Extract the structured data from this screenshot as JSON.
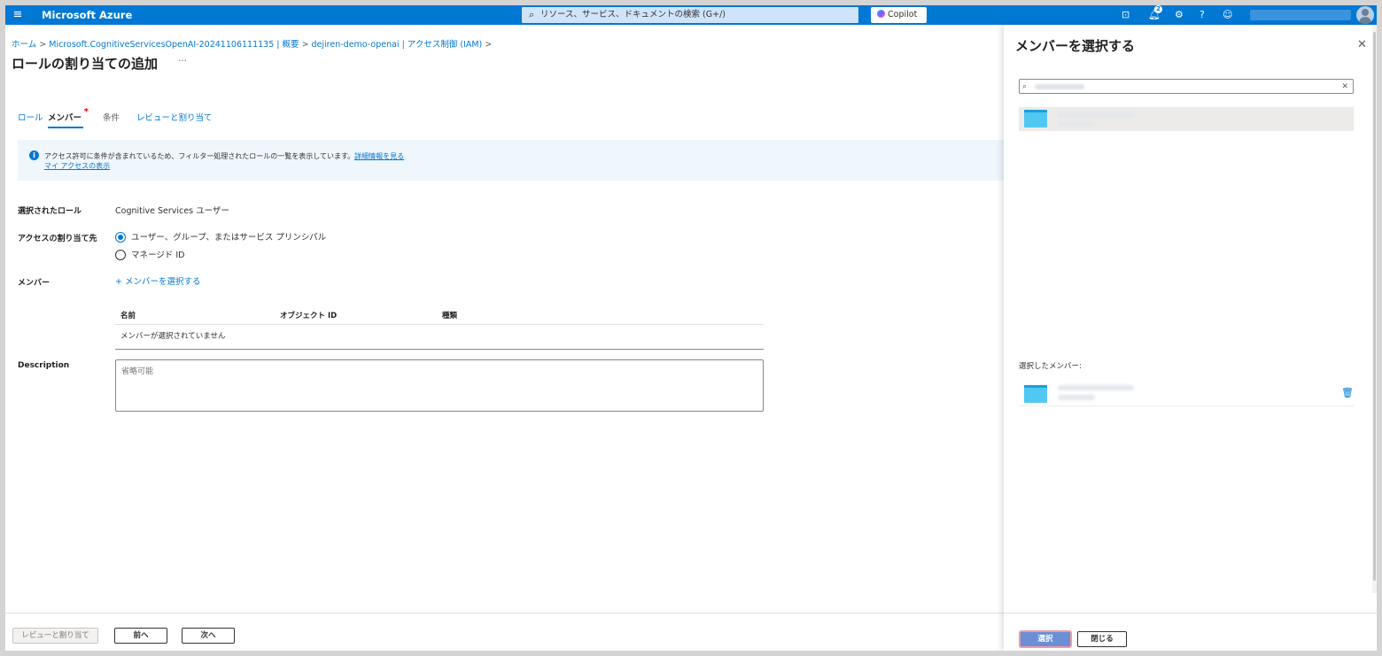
{
  "topbar": {
    "menu_icon": "hamburger-icon",
    "brand": "Microsoft Azure",
    "search_placeholder": "リソース、サービス、ドキュメントの検索 (G+/)",
    "copilot_label": "Copilot",
    "notification_count": "2",
    "icons": [
      "cloud-shell-icon",
      "notifications-icon",
      "settings-icon",
      "help-icon",
      "feedback-icon"
    ]
  },
  "breadcrumb": {
    "items": [
      "ホーム",
      "Microsoft.CognitiveServicesOpenAI-20241106111135 | 概要",
      "dejiren-demo-openai | アクセス制御 (IAM)"
    ],
    "separator": ">"
  },
  "page": {
    "title": "ロールの割り当ての追加",
    "more": "…"
  },
  "tabs": [
    {
      "label": "ロール"
    },
    {
      "label": "メンバー",
      "required_mark": "*"
    },
    {
      "label": "条件"
    },
    {
      "label": "レビューと割り当て"
    }
  ],
  "info": {
    "text": "アクセス許可に条件が含まれているため、フィルター処理されたロールの一覧を表示しています。",
    "link1": "詳細情報を見る",
    "link2": "マイ アクセスの表示"
  },
  "form": {
    "selected_role_label": "選択されたロール",
    "selected_role_value": "Cognitive Services ユーザー",
    "assign_to_label": "アクセスの割り当て先",
    "assign_options": [
      "ユーザー、グループ、またはサービス プリンシパル",
      "マネージド ID"
    ],
    "assign_selected_index": 0,
    "members_label": "メンバー",
    "add_members_link": "+ メンバーを選択する",
    "table_headers": [
      "名前",
      "オブジェクト ID",
      "種類"
    ],
    "table_empty": "メンバーが選択されていません",
    "description_label": "Description",
    "description_placeholder": "省略可能"
  },
  "footer": {
    "review_button": "レビューと割り当て",
    "prev_button": "前へ",
    "next_button": "次へ"
  },
  "panel": {
    "title": "メンバーを選択する",
    "selected_members_label": "選択したメンバー:",
    "select_button": "選択",
    "close_button": "閉じる"
  }
}
